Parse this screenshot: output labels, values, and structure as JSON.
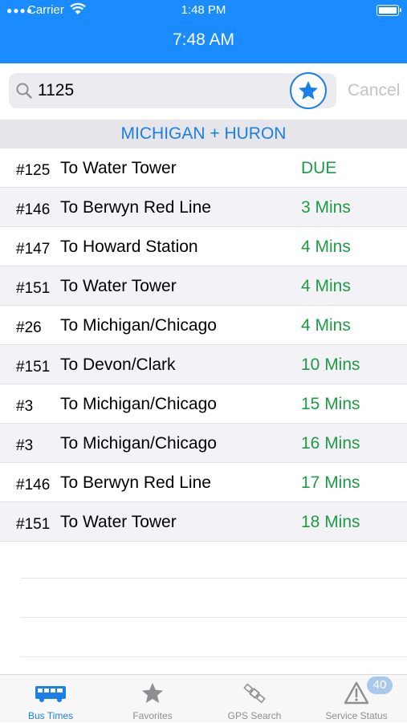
{
  "status_bar": {
    "carrier": "Carrier",
    "time": "1:48 PM"
  },
  "nav": {
    "title": "7:48 AM"
  },
  "search": {
    "value": "1125",
    "cancel_label": "Cancel"
  },
  "stop": {
    "name": "MICHIGAN + HURON"
  },
  "arrivals": [
    {
      "route": "#125",
      "destination": "To Water Tower",
      "eta": "DUE"
    },
    {
      "route": "#146",
      "destination": "To Berwyn Red Line",
      "eta": "3 Mins"
    },
    {
      "route": "#147",
      "destination": "To Howard Station",
      "eta": "4 Mins"
    },
    {
      "route": "#151",
      "destination": "To Water Tower",
      "eta": "4 Mins"
    },
    {
      "route": "#26",
      "destination": "To Michigan/Chicago",
      "eta": "4 Mins"
    },
    {
      "route": "#151",
      "destination": "To Devon/Clark",
      "eta": "10 Mins"
    },
    {
      "route": "#3",
      "destination": "To Michigan/Chicago",
      "eta": "15 Mins"
    },
    {
      "route": "#3",
      "destination": "To Michigan/Chicago",
      "eta": "16 Mins"
    },
    {
      "route": "#146",
      "destination": "To Berwyn Red Line",
      "eta": "17 Mins"
    },
    {
      "route": "#151",
      "destination": "To Water Tower",
      "eta": "18 Mins"
    }
  ],
  "tabs": [
    {
      "label": "Bus Times",
      "icon": "bus-icon",
      "active": true
    },
    {
      "label": "Favorites",
      "icon": "star-icon",
      "active": false
    },
    {
      "label": "GPS Search",
      "icon": "satellite-icon",
      "active": false
    },
    {
      "label": "Service Status",
      "icon": "warning-icon",
      "active": false
    }
  ],
  "service_status_badge": "40",
  "colors": {
    "accent": "#1a8cff",
    "eta_green": "#1e9c45",
    "section_bg": "#e5e5ea",
    "inactive": "#8e8e93"
  }
}
